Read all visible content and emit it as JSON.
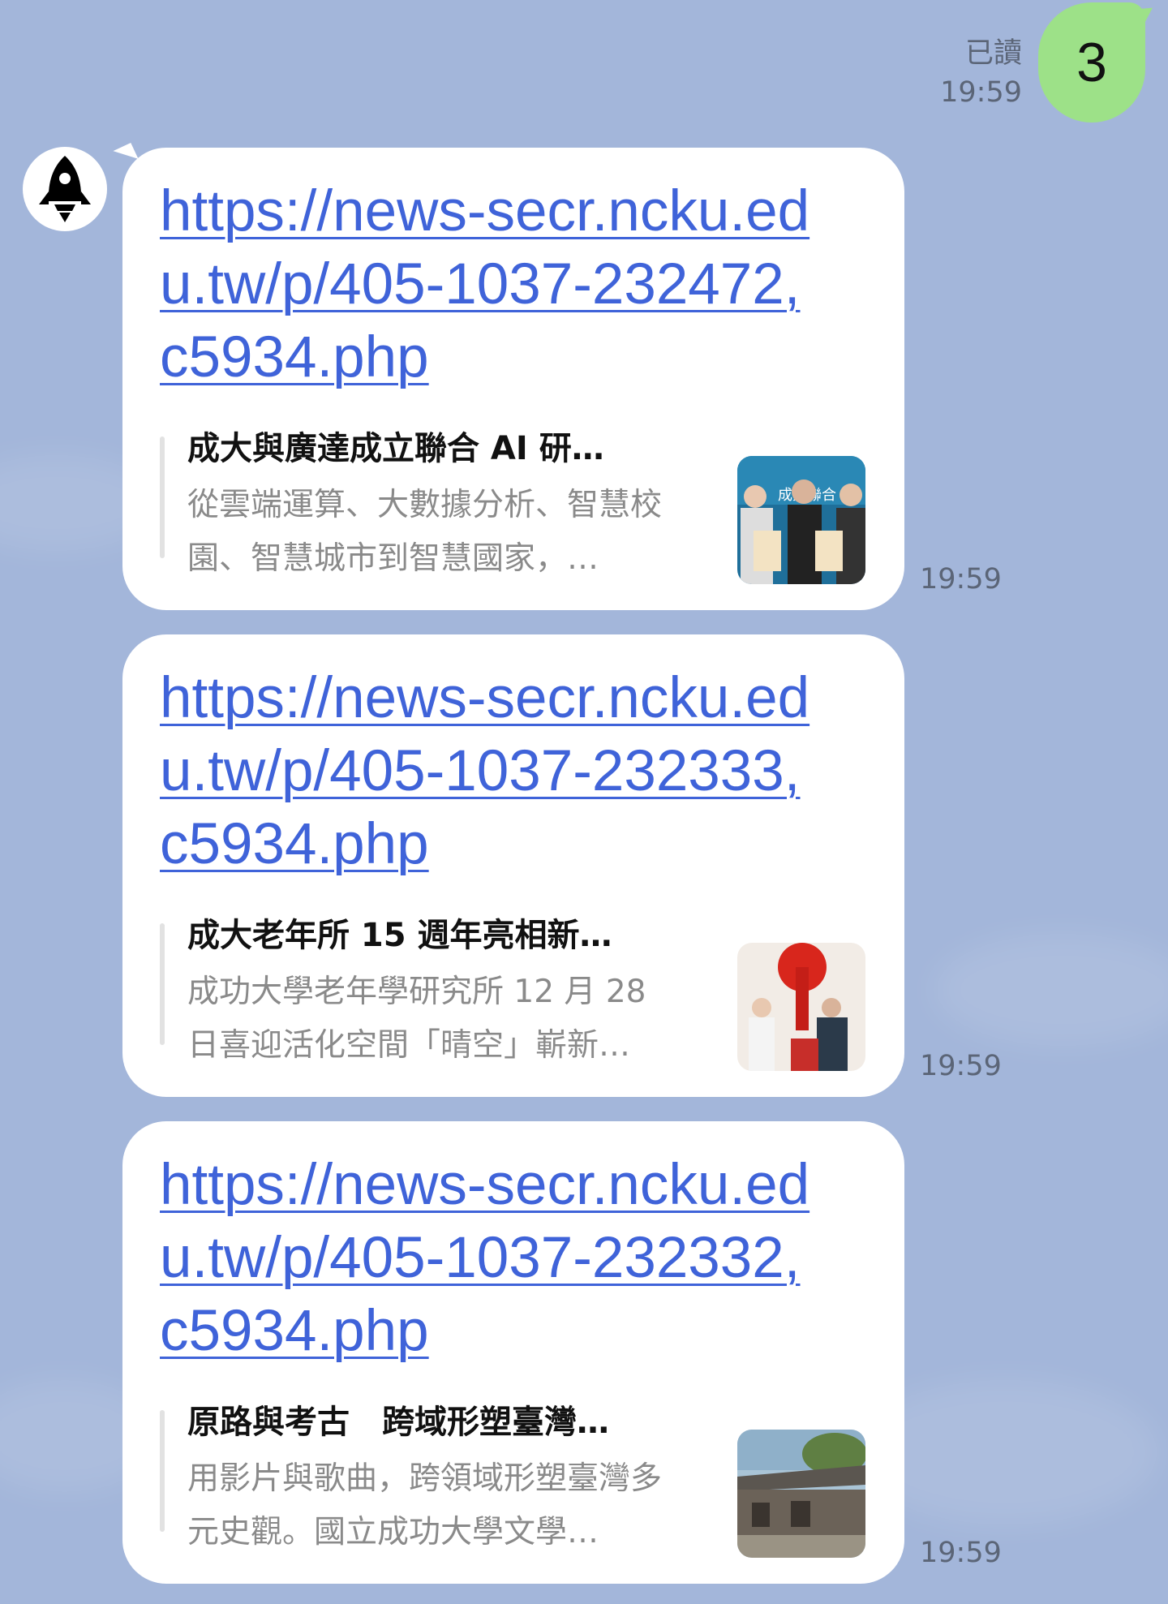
{
  "sent": {
    "read_label": "已讀",
    "time": "19:59",
    "text": "3"
  },
  "avatar": {
    "icon": "rocket-icon"
  },
  "messages": [
    {
      "url": "https://news-secr.ncku.edu.tw/p/405-1037-232472,c5934.php",
      "title": "成大與廣達成立聯合 AI 研…",
      "desc": "從雲端運算、大數據分析、智慧校園、智慧城市到智慧國家，…",
      "time": "19:59"
    },
    {
      "url": "https://news-secr.ncku.edu.tw/p/405-1037-232333,c5934.php",
      "title": "成大老年所 15 週年亮相新…",
      "desc": "成功大學老年學研究所 12 月 28 日喜迎活化空間「晴空」嶄新…",
      "time": "19:59"
    },
    {
      "url": "https://news-secr.ncku.edu.tw/p/405-1037-232332,c5934.php",
      "title": "原路與考古　跨域形塑臺灣…",
      "desc": "用影片與歌曲，跨領域形塑臺灣多元史觀。國立成功大學文學…",
      "time": "19:59"
    }
  ],
  "colors": {
    "background": "#a3b6da",
    "sent_bubble": "#9de188",
    "link": "#3f63d9"
  }
}
